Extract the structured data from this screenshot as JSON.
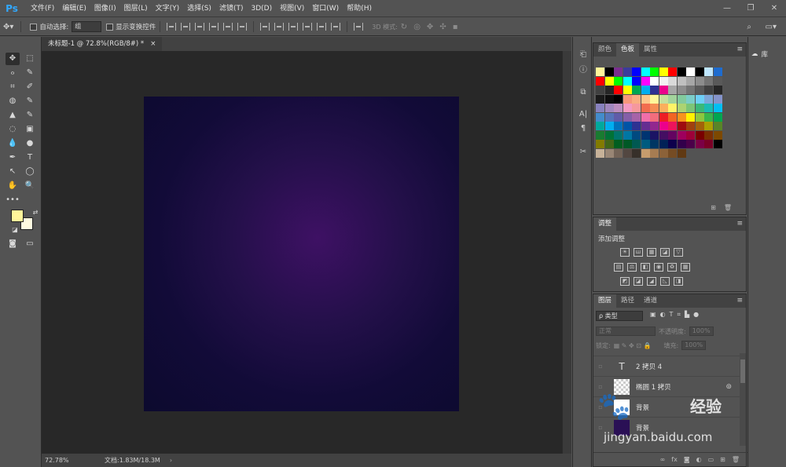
{
  "app": {
    "logo": "Ps",
    "menus": [
      "文件(F)",
      "编辑(E)",
      "图像(I)",
      "图层(L)",
      "文字(Y)",
      "选择(S)",
      "滤镜(T)",
      "3D(D)",
      "视图(V)",
      "窗口(W)",
      "帮助(H)"
    ],
    "window_controls": [
      "—",
      "❐",
      "✕"
    ]
  },
  "options": {
    "auto_select_label": "自动选择:",
    "auto_select_value": "组",
    "show_transform_label": "显示变换控件",
    "mode3d_label": "3D 模式:"
  },
  "document": {
    "tab_title": "未标题-1 @ 72.8%(RGB/8#) *",
    "close": "×",
    "zoom": "72.78%",
    "doc_size": "文档:1.83M/18.3M",
    "arrow": "›"
  },
  "swatches_panel": {
    "tabs": [
      "颜色",
      "色板",
      "属性"
    ],
    "active_tab": "色板",
    "rows": [
      [
        "#fff59a",
        "#000000",
        "#7a2f8f",
        "#3b3b9c",
        "#0000ff",
        "#00ffff",
        "#00ff00",
        "#ffff00",
        "#ff0000",
        "#000000",
        "#ffffff",
        "#000000",
        "#bfe6ff",
        "#1e6ccf"
      ],
      [
        "#ff0000",
        "#ffff00",
        "#00ff00",
        "#00ffff",
        "#0000ff",
        "#ff00ff",
        "#ffffff",
        "#f2f2f2",
        "#d9d9d9",
        "#bfbfbf",
        "#a6a6a6",
        "#8c8c8c",
        "#737373",
        "#595959"
      ],
      [
        "#404040",
        "#262626",
        "#ff0000",
        "#ffff00",
        "#00a651",
        "#00aeef",
        "#2e3192",
        "#ec008c",
        "#a6a6a6",
        "#8c8c8c",
        "#737373",
        "#595959",
        "#404040",
        "#262626"
      ],
      [
        "#1a1a1a",
        "#0d0d0d",
        "#000000",
        "#f7977a",
        "#f9ad81",
        "#fdc68a",
        "#fff79a",
        "#c4df9b",
        "#a2d39c",
        "#82ca9d",
        "#7bcdc8",
        "#6ecff6",
        "#7ea7d8",
        "#8493ca"
      ],
      [
        "#8882be",
        "#a187be",
        "#bc8dbf",
        "#f49ac2",
        "#f6989d",
        "#f26c4f",
        "#f68e55",
        "#fbaf5c",
        "#fff467",
        "#acd372",
        "#7cc576",
        "#3bb878",
        "#1abbb4",
        "#00bff3"
      ],
      [
        "#438ccb",
        "#5574b9",
        "#605ca8",
        "#855fa8",
        "#a763a8",
        "#f06eaa",
        "#f26d7d",
        "#ed1c24",
        "#f26522",
        "#f7941d",
        "#fff200",
        "#8dc63f",
        "#39b54a",
        "#00a651"
      ],
      [
        "#00a99d",
        "#00aeef",
        "#0072bc",
        "#0054a6",
        "#2e3192",
        "#662d91",
        "#92278f",
        "#ec008c",
        "#ed145b",
        "#9e0b0f",
        "#a0410d",
        "#a36209",
        "#aba000",
        "#598527"
      ],
      [
        "#197b30",
        "#007236",
        "#00746b",
        "#0076a3",
        "#004a80",
        "#003471",
        "#1b1464",
        "#440e62",
        "#630460",
        "#9e005d",
        "#9e0039",
        "#790000",
        "#7b2e00",
        "#7d4900"
      ],
      [
        "#827b00",
        "#406618",
        "#005e20",
        "#005826",
        "#005952",
        "#005b7f",
        "#003663",
        "#002157",
        "#0d004c",
        "#32004b",
        "#4b0049",
        "#7b0046",
        "#7a0026",
        "#000000"
      ],
      [
        "#c7b299",
        "#998675",
        "#736357",
        "#534741",
        "#37302a",
        "#c69c6d",
        "#a67c52",
        "#8c6239",
        "#754c24",
        "#603913"
      ]
    ]
  },
  "adjustments_panel": {
    "tab": "调整",
    "add_label": "添加调整",
    "row1": [
      "☀",
      "ш",
      "▦",
      "◪",
      "▽"
    ],
    "row2": [
      "▤",
      "⚖",
      "◧",
      "◉",
      "♻",
      "▦"
    ],
    "row3": [
      "◩",
      "◪",
      "◢",
      "◺",
      "◨"
    ]
  },
  "layers_panel": {
    "tabs": [
      "图层",
      "路径",
      "通道"
    ],
    "active_tab": "图层",
    "filter": "ρ 类型",
    "filter_icons": [
      "▣",
      "◐",
      "T",
      "⌗",
      "▙",
      "●"
    ],
    "blend_mode": "正常",
    "opacity_label": "不透明度:",
    "opacity_value": "100%",
    "lock_label": "锁定:",
    "fill_label": "填充:",
    "fill_value": "100%",
    "layers": [
      {
        "name": "2 拷贝 4",
        "type": "text",
        "thumb": "T"
      },
      {
        "name": "椭圆 1 拷贝",
        "type": "shape",
        "thumb": ""
      },
      {
        "name": "背景",
        "type": "fill",
        "thumb": ""
      },
      {
        "name": "背景",
        "type": "image",
        "thumb": ""
      }
    ],
    "footer_icons": [
      "∞",
      "fx",
      "◙",
      "◐",
      "▭",
      "⊞",
      "🗑"
    ]
  },
  "library": {
    "label": "库"
  },
  "watermark": {
    "logo": "🐾",
    "brand": "经验",
    "url": "jingyan.baidu.com"
  },
  "tools": [
    "✥",
    "⬚",
    "ℴ",
    "✎",
    "⌗",
    "✐",
    "◍",
    "✎",
    "▲",
    "✎",
    "◌",
    "▣",
    "💧",
    "●",
    "✒",
    "T",
    "↖",
    "◯",
    "✋",
    "🔍",
    "•••"
  ]
}
